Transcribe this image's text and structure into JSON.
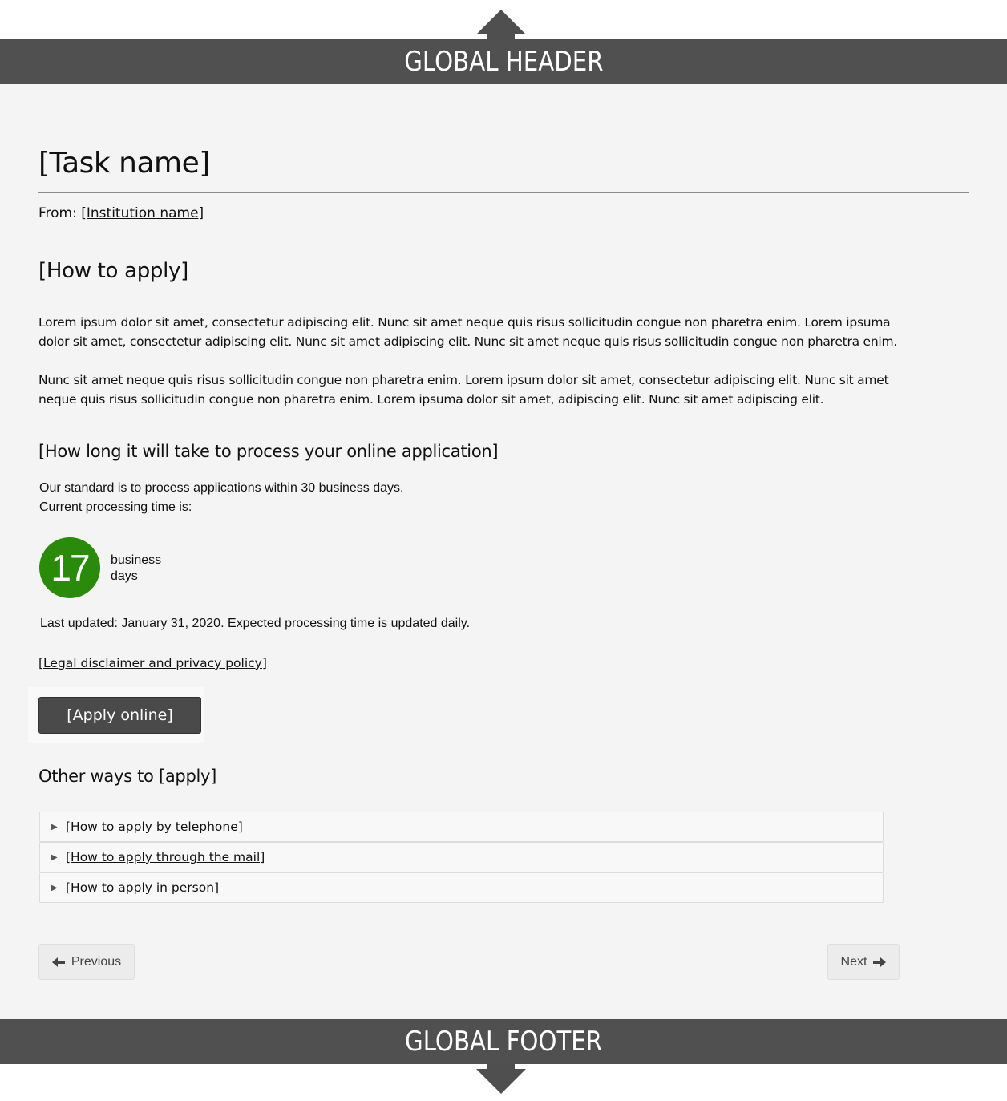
{
  "global_header": {
    "label": "GLOBAL HEADER",
    "icon": "arrow-up-icon"
  },
  "global_footer": {
    "label": "GLOBAL FOOTER",
    "icon": "arrow-down-icon"
  },
  "page": {
    "title": "[Task name]",
    "from_label": "From:",
    "institution_link": "[Institution name]"
  },
  "how_to_apply": {
    "heading": "[How to apply]",
    "paragraphs": [
      "Lorem ipsum dolor sit amet, consectetur adipiscing elit. Nunc sit amet neque quis  risus sollicitudin congue non pharetra enim. Lorem ipsuma dolor sit amet, consectetur adipiscing elit. Nunc sit amet adipiscing elit. Nunc sit amet neque quis risus sollicitudin congue non pharetra enim.",
      "Nunc sit amet neque quis risus sollicitudin congue non pharetra enim.  Lorem ipsum dolor sit amet, consectetur adipiscing elit. Nunc sit amet neque quis  risus sollicitudin congue non pharetra enim. Lorem ipsuma dolor sit amet, adipiscing elit. Nunc sit amet adipiscing elit."
    ]
  },
  "processing": {
    "heading": "[How long it will take to process your online application]",
    "standard_text": "Our standard is to process applications within 30 business days.",
    "current_label": "Current processing time is:",
    "days_value": "17",
    "days_unit_line1": "business",
    "days_unit_line2": "days",
    "badge_color": "#2a8a0a",
    "last_updated": "Last updated: January 31, 2020. Expected processing time is updated daily."
  },
  "legal_link": "[Legal disclaimer and privacy policy]",
  "apply_button": "[Apply online]",
  "other_ways": {
    "heading": "Other ways to [apply]",
    "items": [
      {
        "label": "[How to apply by telephone]"
      },
      {
        "label": "[How to apply through the mail]"
      },
      {
        "label": "[How to apply in person]"
      }
    ]
  },
  "pagination": {
    "previous_label": "Previous",
    "next_label": "Next"
  }
}
